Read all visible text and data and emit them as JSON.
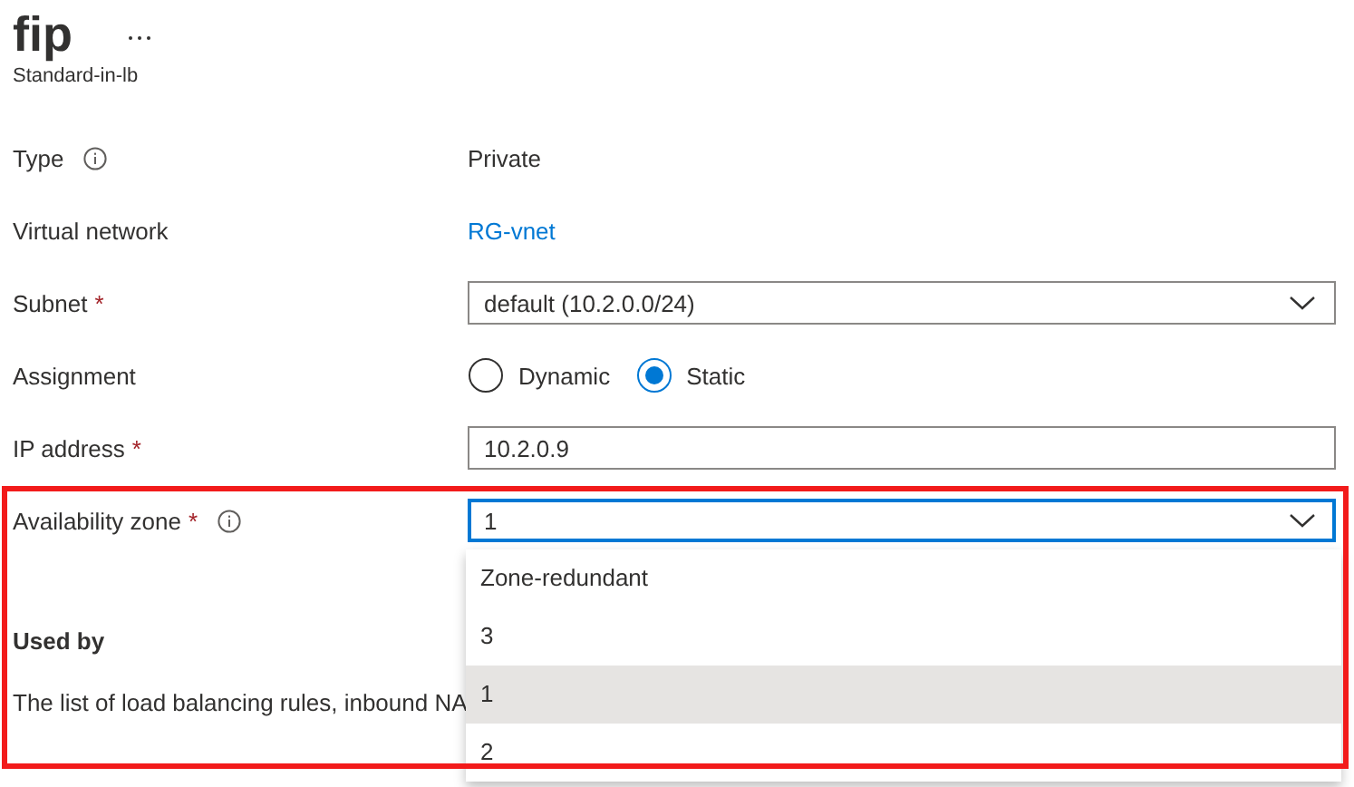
{
  "header": {
    "title": "fip",
    "subtitle": "Standard-in-lb"
  },
  "fields": [
    {
      "kind": "text",
      "label": "Type",
      "info": true,
      "value": "Private"
    },
    {
      "kind": "link",
      "label": "Virtual network",
      "value": "RG-vnet"
    },
    {
      "kind": "select",
      "label": "Subnet",
      "required_mark": "*",
      "value": "default (10.2.0.0/24)"
    },
    {
      "kind": "radio",
      "label": "Assignment",
      "options": [
        {
          "label": "Dynamic",
          "selected": false
        },
        {
          "label": "Static",
          "selected": true
        }
      ]
    },
    {
      "kind": "input",
      "label": "IP address",
      "required_mark": "*",
      "value": "10.2.0.9"
    },
    {
      "kind": "select",
      "label": "Availability zone",
      "required_mark": "*",
      "info": true,
      "value": "1",
      "focused": true,
      "open": true
    }
  ],
  "dropdown": {
    "options": [
      {
        "label": "Zone-redundant",
        "selected": false
      },
      {
        "label": "3",
        "selected": false
      },
      {
        "label": "1",
        "selected": true
      },
      {
        "label": "2",
        "selected": false
      }
    ]
  },
  "used_by": {
    "title": "Used by",
    "description": "The list of load balancing rules, inbound NA"
  }
}
